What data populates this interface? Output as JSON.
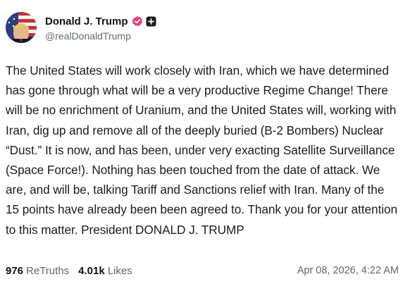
{
  "post": {
    "author": {
      "display_name": "Donald J. Trump",
      "handle": "@realDonaldTrump",
      "avatar_icon": "profile-avatar",
      "verified_icon": "verified-badge-icon",
      "verified_color": "#e8437a",
      "plus_icon": "plus-badge-icon"
    },
    "body": "The United States will work closely with Iran, which we have determined has gone through what will be a very productive Regime Change! There will be no enrichment of Uranium, and the United States will, working with Iran, dig up and remove all of the deeply buried (B-2 Bombers) Nuclear “Dust.” It is now, and has been, under very exacting Satellite Surveillance (Space Force!). Nothing has been touched from the date of attack. We are, and will be, talking Tariff and Sanctions relief with Iran. Many of the 15 points have already been been agreed to. Thank you for your attention to this matter. President DONALD J. TRUMP",
    "stats": {
      "retruths_count": "976",
      "retruths_label": "ReTruths",
      "likes_count": "4.01k",
      "likes_label": "Likes"
    },
    "timestamp": "Apr 08, 2026, 4:22 AM"
  }
}
